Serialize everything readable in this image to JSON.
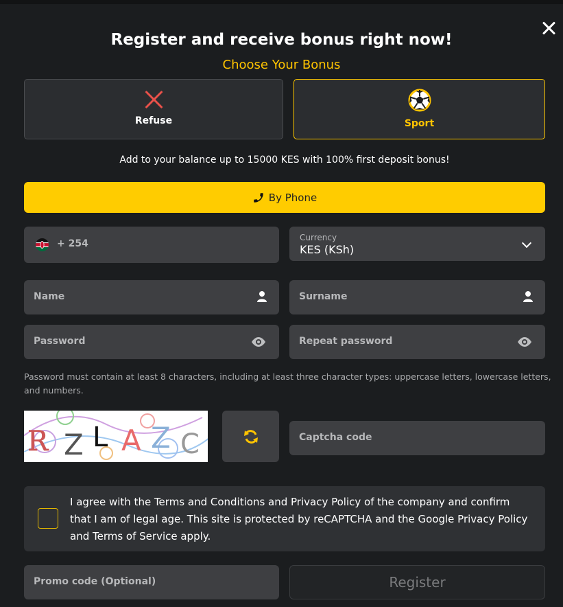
{
  "header": {
    "title": "Register and receive bonus right now!",
    "subtitle": "Choose Your Bonus"
  },
  "bonus": {
    "options": [
      {
        "label": "Refuse",
        "icon": "x-icon",
        "selected": false
      },
      {
        "label": "Sport",
        "icon": "soccer-ball-icon",
        "selected": true
      }
    ],
    "description": "Add to your balance up to 15000 KES with 100% first deposit bonus!"
  },
  "tabs": {
    "phone_label": "By Phone",
    "phone_icon": "phone-icon"
  },
  "form": {
    "phone_code": "+ 254",
    "currency_label": "Currency",
    "currency_value": "KES (KSh)",
    "name_placeholder": "Name",
    "surname_placeholder": "Surname",
    "password_placeholder": "Password",
    "repeat_password_placeholder": "Repeat password",
    "password_hint": "Password must contain at least 8 characters, including at least three character types: uppercase letters, lowercase letters, and numbers.",
    "captcha_text": "RZLAZC",
    "captcha_placeholder": "Captcha code",
    "agree_text": "I agree with the Terms and Conditions and Privacy Policy of the company and confirm that I am of legal age. This site is protected by reCAPTCHA and the Google Privacy Policy and Terms of Service apply.",
    "promo_placeholder": "Promo code (Optional)",
    "register_label": "Register"
  },
  "colors": {
    "background": "#1b1d1f",
    "accent": "#ffcc00",
    "field": "#3e3f42",
    "refuse_icon": "#e8514a"
  }
}
